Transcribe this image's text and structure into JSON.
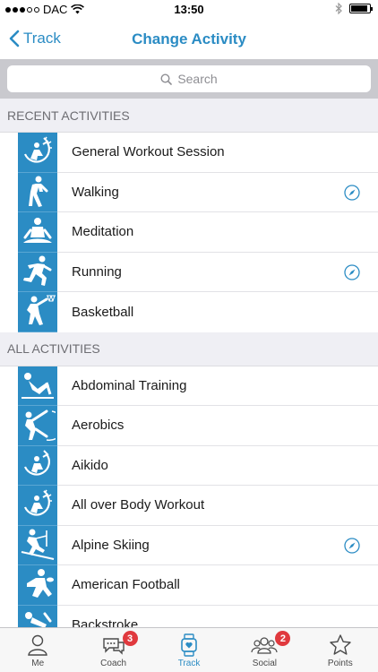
{
  "status_bar": {
    "carrier": "DAC",
    "time": "13:50"
  },
  "nav": {
    "back_label": "Track",
    "title": "Change Activity"
  },
  "search": {
    "placeholder": "Search"
  },
  "sections": {
    "recent": {
      "header": "RECENT ACTIVITIES",
      "items": [
        {
          "label": "General Workout Session",
          "icon": "workout-icon",
          "gps": false
        },
        {
          "label": "Walking",
          "icon": "walking-icon",
          "gps": true
        },
        {
          "label": "Meditation",
          "icon": "meditation-icon",
          "gps": false
        },
        {
          "label": "Running",
          "icon": "running-icon",
          "gps": true
        },
        {
          "label": "Basketball",
          "icon": "basketball-icon",
          "gps": false
        }
      ]
    },
    "all": {
      "header": "ALL ACTIVITIES",
      "items": [
        {
          "label": "Abdominal Training",
          "icon": "abdominal-icon",
          "gps": false
        },
        {
          "label": "Aerobics",
          "icon": "aerobics-icon",
          "gps": false
        },
        {
          "label": "Aikido",
          "icon": "aikido-icon",
          "gps": false
        },
        {
          "label": "All over Body Workout",
          "icon": "body-workout-icon",
          "gps": false
        },
        {
          "label": "Alpine Skiing",
          "icon": "skiing-icon",
          "gps": true
        },
        {
          "label": "American Football",
          "icon": "football-icon",
          "gps": false
        },
        {
          "label": "Backstroke",
          "icon": "swimming-icon",
          "gps": false
        }
      ]
    }
  },
  "tabs": [
    {
      "label": "Me",
      "icon": "person-icon",
      "badge": ""
    },
    {
      "label": "Coach",
      "icon": "chat-icon",
      "badge": "3"
    },
    {
      "label": "Track",
      "icon": "watch-icon",
      "badge": ""
    },
    {
      "label": "Social",
      "icon": "group-icon",
      "badge": "2"
    },
    {
      "label": "Points",
      "icon": "star-icon",
      "badge": ""
    }
  ],
  "colors": {
    "accent": "#2b8cc4",
    "badge": "#e0393e",
    "section_bg": "#efeff4"
  }
}
